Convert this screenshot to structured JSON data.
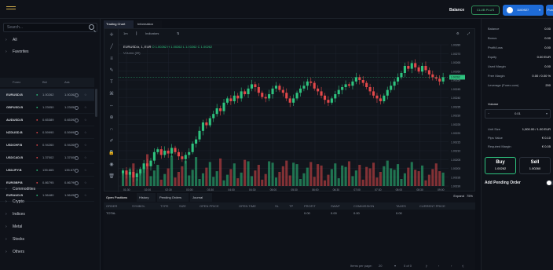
{
  "header": {
    "balance_label": "Balance",
    "club_label": "CLUB PLUS",
    "account_label": "1100927",
    "right_btn": "Fun"
  },
  "sidebar": {
    "search_placeholder": "Search...",
    "categories_top": [
      "All",
      "Favorites"
    ],
    "columns": {
      "name": "Forex",
      "bid": "Bid",
      "ask": "Ask"
    },
    "symbols": [
      {
        "name": "EURUSD.B",
        "bid": "1.00262",
        "ask": "1.00262",
        "dir": "up"
      },
      {
        "name": "GBPUSD.B",
        "bid": "1.23050",
        "ask": "1.23059",
        "dir": "up"
      },
      {
        "name": "AUDUSD.B",
        "bid": "0.65389",
        "ask": "0.65392",
        "dir": "down"
      },
      {
        "name": "NZDUSD.B",
        "bid": "0.59990",
        "ask": "0.59995",
        "dir": "down"
      },
      {
        "name": "USDCHF.B",
        "bid": "0.94260",
        "ask": "0.94269",
        "dir": "down"
      },
      {
        "name": "USDCAD.B",
        "bid": "1.37002",
        "ask": "1.37009",
        "dir": "down"
      },
      {
        "name": "USDJPY.B",
        "bid": "135.665",
        "ask": "135.672",
        "dir": "up"
      },
      {
        "name": "EURGBP.B",
        "bid": "0.86795",
        "ask": "0.86799",
        "dir": "down"
      },
      {
        "name": "EURAUD.B",
        "bid": "1.56480",
        "ask": "1.56496",
        "dir": "up"
      }
    ],
    "categories_bottom": [
      "Commodities",
      "Crypto",
      "Indices",
      "Metal",
      "Stocks",
      "Others"
    ]
  },
  "chart_tabs": [
    "Trading Chart",
    "Information"
  ],
  "chart_toolbar": {
    "interval": "1m",
    "indicators": "Indicators"
  },
  "chart_legend": {
    "symbol": "EURUSD.b, 1, EUR",
    "o": "O 1.00262",
    "h": "H 1.00262",
    "l": "L 1.00262",
    "c": "C 1.00262",
    "volume": "Volume (20)"
  },
  "chart_data": {
    "type": "candlestick",
    "y_ticks": [
      "1.00280",
      "1.00270",
      "1.00265",
      "1.00260",
      "1.00250",
      "1.00245",
      "1.00240",
      "1.00235",
      "1.00230",
      "1.00225",
      "1.00220",
      "1.00215",
      "1.00210",
      "1.00205",
      "1.00200",
      "1.00195",
      "1.00190"
    ],
    "x_ticks": [
      "01:30",
      "02:00",
      "02:30",
      "03:00",
      "03:30",
      "04:00",
      "04:30",
      "05:00",
      "05:30",
      "06:00",
      "06:30",
      "07:00",
      "07:30",
      "08:00",
      "08:30",
      "09:00"
    ],
    "close": [
      1.00196,
      1.00193,
      1.00195,
      1.00191,
      1.00194,
      1.00197,
      1.00201,
      1.00199,
      1.00203,
      1.00209,
      1.00211,
      1.00207,
      1.0021,
      1.00208,
      1.00212,
      1.00209,
      1.00206,
      1.00204,
      1.00207,
      1.00209,
      1.00215,
      1.00218,
      1.00224,
      1.0023,
      1.00228,
      1.00233,
      1.00236,
      1.0024,
      1.00238,
      1.00244,
      1.00247,
      1.00245,
      1.00249,
      1.00247,
      1.00252,
      1.0025,
      1.00254,
      1.00257,
      1.00255,
      1.00251,
      1.00248,
      1.00247,
      1.0025,
      1.00254,
      1.00256,
      1.00253,
      1.00251,
      1.00247,
      1.00244,
      1.00247,
      1.00251,
      1.00254,
      1.00256,
      1.00259,
      1.00258,
      1.00254,
      1.00252,
      1.00249,
      1.00246,
      1.00244,
      1.00247,
      1.0025,
      1.00253,
      1.00255,
      1.00257,
      1.00256,
      1.00259,
      1.00262,
      1.0026,
      1.00258,
      1.00255,
      1.00252,
      1.00249,
      1.00247,
      1.00245,
      1.00249,
      1.00253,
      1.00256,
      1.00259,
      1.00262,
      1.00265,
      1.0027,
      1.00268,
      1.00272,
      1.00269,
      1.00266,
      1.0027,
      1.00267,
      1.00264,
      1.00262,
      1.00261,
      1.00259,
      1.00262
    ],
    "current_price": "1.00262",
    "ylim": [
      1.00185,
      1.00285
    ]
  },
  "bottom_tabs": [
    "Open Positions",
    "History",
    "Pending Orders",
    "Journal"
  ],
  "bottom_controls": {
    "expand": "Expand",
    "percent": "75%"
  },
  "table_headers": [
    "ORDER",
    "SYMBOL",
    "TYPE",
    "SIZE",
    "OPEN PRICE",
    "OPEN TIME",
    "SL",
    "TP",
    "PROFIT",
    "SWAP",
    "COMMISSION",
    "TAXES",
    "CURRENT PRICE"
  ],
  "table_total": {
    "label": "TOTAL",
    "profit": "0.00",
    "swap": "0.00",
    "commission": "0.00",
    "taxes": "0.00"
  },
  "pager": {
    "items_label": "Items per page:",
    "per_page": "20",
    "range": "0 of 0"
  },
  "account_info": [
    {
      "k": "Balance",
      "v": "0.00"
    },
    {
      "k": "Bonus",
      "v": "0.00"
    },
    {
      "k": "Profit/Loss",
      "v": "0.00"
    },
    {
      "k": "Equity",
      "v": "0.00 EUR"
    },
    {
      "k": "Used Margin",
      "v": "0.00"
    },
    {
      "k": "Free Margin",
      "v": "0.00 / 0.00 %"
    },
    {
      "k": "Leverage (Forex.com)",
      "v": "200"
    }
  ],
  "volume": {
    "label": "Volume",
    "value": "0.01"
  },
  "order_info": [
    {
      "k": "Unit Size",
      "v": "1,000.00 / 1.00 EUR"
    },
    {
      "k": "Pips Value",
      "v": "€ 0.10"
    },
    {
      "k": "Required Margin",
      "v": "€ 0.05"
    }
  ],
  "buy": {
    "label": "Buy",
    "price": "1.00262"
  },
  "sell": {
    "label": "Sell",
    "price": "1.00260"
  },
  "pending_label": "Add Pending Order"
}
